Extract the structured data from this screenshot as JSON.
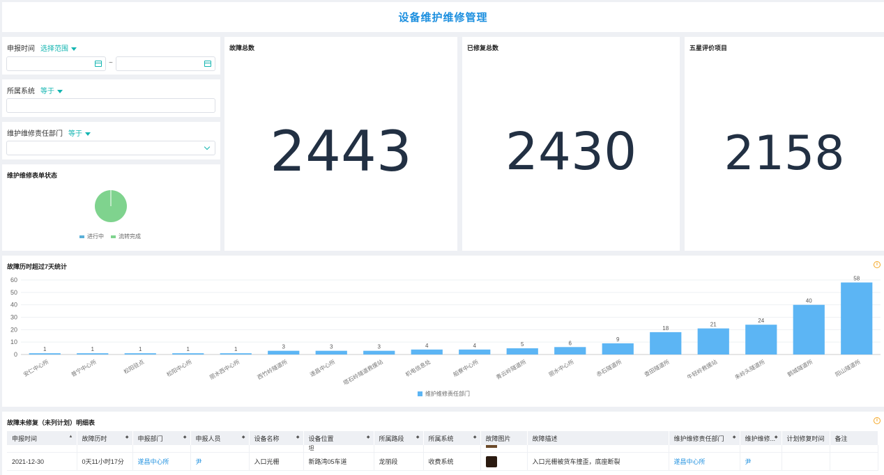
{
  "header": {
    "title": "设备维护维修管理"
  },
  "filters": {
    "date": {
      "label": "申报时间",
      "op": "选择范围",
      "sep": "~"
    },
    "system": {
      "label": "所属系统",
      "op": "等于"
    },
    "dept": {
      "label": "维护维修责任部门",
      "op": "等于"
    }
  },
  "status": {
    "title": "维护维修表单状态",
    "legend": [
      "进行中",
      "流转完成"
    ],
    "colors": [
      "#5ab0d8",
      "#7fd38e"
    ]
  },
  "kpis": [
    {
      "title": "故障总数",
      "value": "2443"
    },
    {
      "title": "已修复总数",
      "value": "2430"
    },
    {
      "title": "五星评价项目",
      "value": "2158"
    }
  ],
  "chart_card": {
    "title": "故障历时超过7天统计"
  },
  "chart_data": {
    "type": "bar",
    "categories": [
      "安仁中心所",
      "普宁中心所",
      "松阳驻点",
      "松阳中心所",
      "丽水西中心所",
      "西竹岭隧道所",
      "遂昌中心所",
      "塔石岭隧道救援站",
      "机电信息处",
      "船寮中心所",
      "青云岭隧道所",
      "丽水中心所",
      "赤石隧道所",
      "查田隧道所",
      "牛轻岭救援站",
      "朱岭头隧道所",
      "鹤城隧道所",
      "阳山隧道所"
    ],
    "series": [
      {
        "name": "维护维修责任部门",
        "values": [
          1,
          1,
          1,
          1,
          1,
          3,
          3,
          3,
          4,
          4,
          5,
          6,
          9,
          18,
          21,
          24,
          40,
          58
        ]
      }
    ],
    "yticks": [
      0,
      10,
      20,
      30,
      40,
      50,
      60
    ],
    "ylim": [
      0,
      60
    ],
    "color": "#5cb5f4"
  },
  "table_card": {
    "title": "故障未修复（未列计划）明细表"
  },
  "table": {
    "columns": [
      "申报时间",
      "故障历时",
      "申报部门",
      "申报人员",
      "设备名称",
      "设备位置",
      "所属路段",
      "所属系统",
      "故障图片",
      "故障描述",
      "维护维修责任部门",
      "维护维修...",
      "计划修复时间",
      "备注"
    ],
    "partial_row": {
      "location": "坦"
    },
    "rows": [
      {
        "date": "2021-12-30",
        "duration": "0天11小时17分",
        "dept": "遂昌中心所",
        "person": "尹",
        "equipment": "入口光栅",
        "location": "新路湾05车道",
        "section": "龙丽段",
        "system": "收费系统",
        "desc": "入口光栅被货车撞歪，底座断裂",
        "resp_dept": "遂昌中心所",
        "resp": "尹"
      }
    ]
  }
}
